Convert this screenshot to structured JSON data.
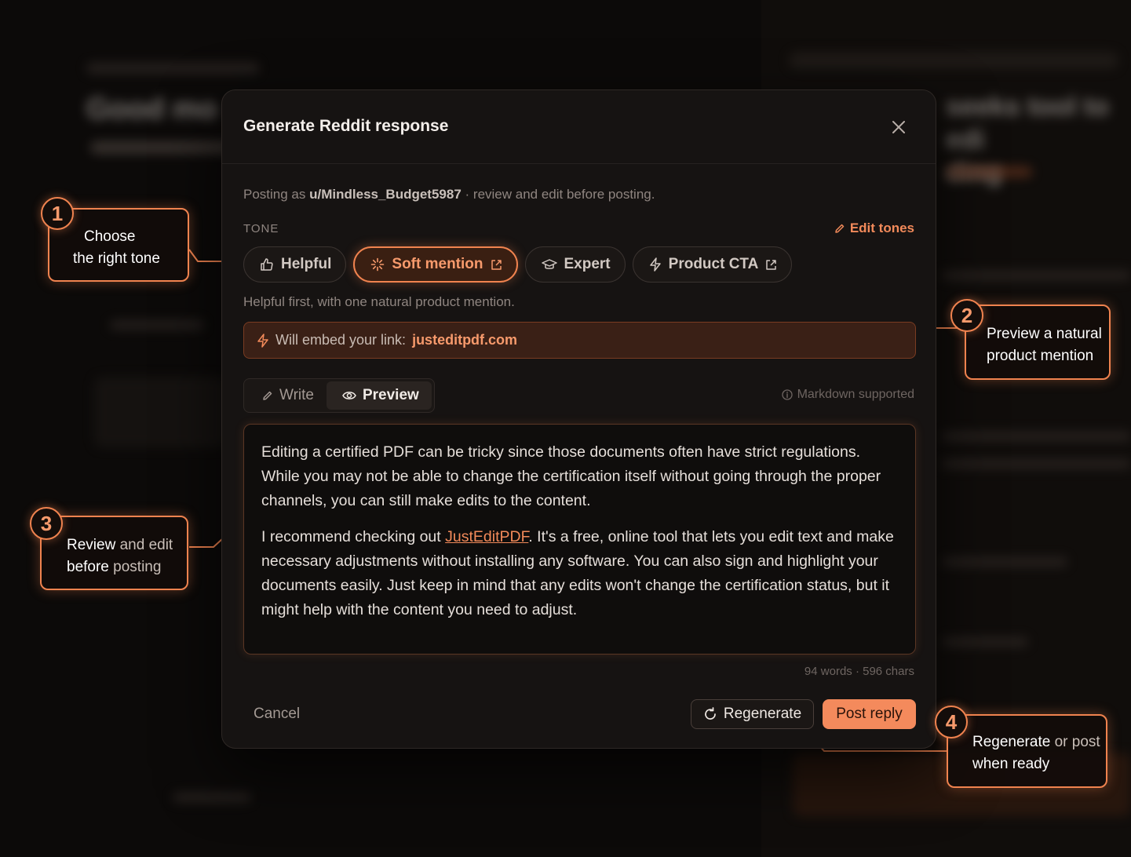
{
  "backdrop": {
    "title": "Good mo",
    "right_title": "seeks tool to edi",
    "right_title_2": "ding"
  },
  "modal": {
    "title": "Generate Reddit response",
    "posting_prefix": "Posting as",
    "username": "u/Mindless_Budget5987",
    "posting_suffix": "· review and edit before posting.",
    "tone_label": "TONE",
    "edit_tones": "Edit tones",
    "tones": [
      {
        "label": "Helpful",
        "icon": "thumbs-up-icon",
        "external": false,
        "active": false
      },
      {
        "label": "Soft mention",
        "icon": "sparkle-icon",
        "external": true,
        "active": true
      },
      {
        "label": "Expert",
        "icon": "graduation-cap-icon",
        "external": false,
        "active": false
      },
      {
        "label": "Product CTA",
        "icon": "bolt-icon",
        "external": true,
        "active": false
      }
    ],
    "tone_description": "Helpful first, with one natural product mention.",
    "embed_prefix": "Will embed your link:",
    "embed_link": "justeditpdf.com",
    "modes": {
      "write": "Write",
      "preview": "Preview",
      "active": "preview"
    },
    "markdown_note": "Markdown supported",
    "body": {
      "p1": "Editing a certified PDF can be tricky since those documents often have strict regulations. While you may not be able to change the certification itself without going through the proper channels, you can still make edits to the content.",
      "p2_before": "I recommend checking out ",
      "p2_link": "JustEditPDF",
      "p2_after": ". It's a free, online tool that lets you edit text and make necessary adjustments without installing any software. You can also sign and highlight your documents easily. Just keep in mind that any edits won't change the certification status, but it might help with the content you need to adjust."
    },
    "counts": "94 words · 596 chars",
    "cancel": "Cancel",
    "regenerate": "Regenerate",
    "post": "Post reply"
  },
  "callouts": [
    {
      "number": "1",
      "line1": "Choose",
      "line2": "the right tone"
    },
    {
      "number": "2",
      "line1": "Preview a natural",
      "line2": "product mention"
    },
    {
      "number": "3",
      "line1_a": "Review",
      "line1_b": " and edit",
      "line2_a": "before",
      "line2_b": " posting"
    },
    {
      "number": "4",
      "line1_a": "Regenerate",
      "line1_b": " or post",
      "line2": "when ready"
    }
  ],
  "colors": {
    "accent": "#f0834f",
    "background": "#0a0807",
    "modal": "#161312"
  }
}
